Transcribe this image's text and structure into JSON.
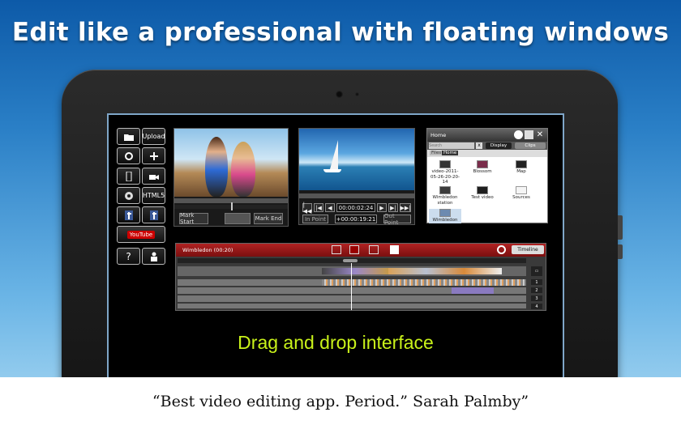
{
  "headline": "Edit like a professional with floating windows",
  "quote": "“Best video editing app. Period.” Sarah Palmby”",
  "caption": "Drag and drop interface",
  "toolbar": {
    "upload_label": "Upload",
    "html5_label": "HTML5",
    "youtube_label": "YouTube"
  },
  "photo_panel": {
    "mark_start": "Mark Start",
    "mark_end": "Mark End"
  },
  "player": {
    "timecode": "00:00:02:24",
    "in_point": "In Point",
    "duration": "+00:00:19:21",
    "out_point": "Out Point"
  },
  "browser": {
    "title": "Home",
    "search_placeholder": "Search",
    "display_label": "Display",
    "clips_label": "Clips",
    "tab_files": "Files",
    "tab_home": "Home",
    "items": [
      {
        "label": "video-2011-05-26-20-20-14",
        "icon": "film-icon"
      },
      {
        "label": "Blossom",
        "icon": "film-icon"
      },
      {
        "label": "Map",
        "icon": "film-icon"
      },
      {
        "label": "Wimbledon station",
        "icon": "film-icon"
      },
      {
        "label": "Test video",
        "icon": "film-icon"
      },
      {
        "label": "Sources",
        "icon": "folder-icon"
      },
      {
        "label": "Wimbledon",
        "icon": "film-icon"
      }
    ]
  },
  "timeline": {
    "title": "Wimbledon (00:20)",
    "mode_label": "Timeline",
    "track_labels": [
      "1",
      "2",
      "3",
      "4"
    ]
  },
  "colors": {
    "caption": "#c9f21a",
    "timeline_header": "#b02222",
    "background_top": "#0d5aa8"
  }
}
